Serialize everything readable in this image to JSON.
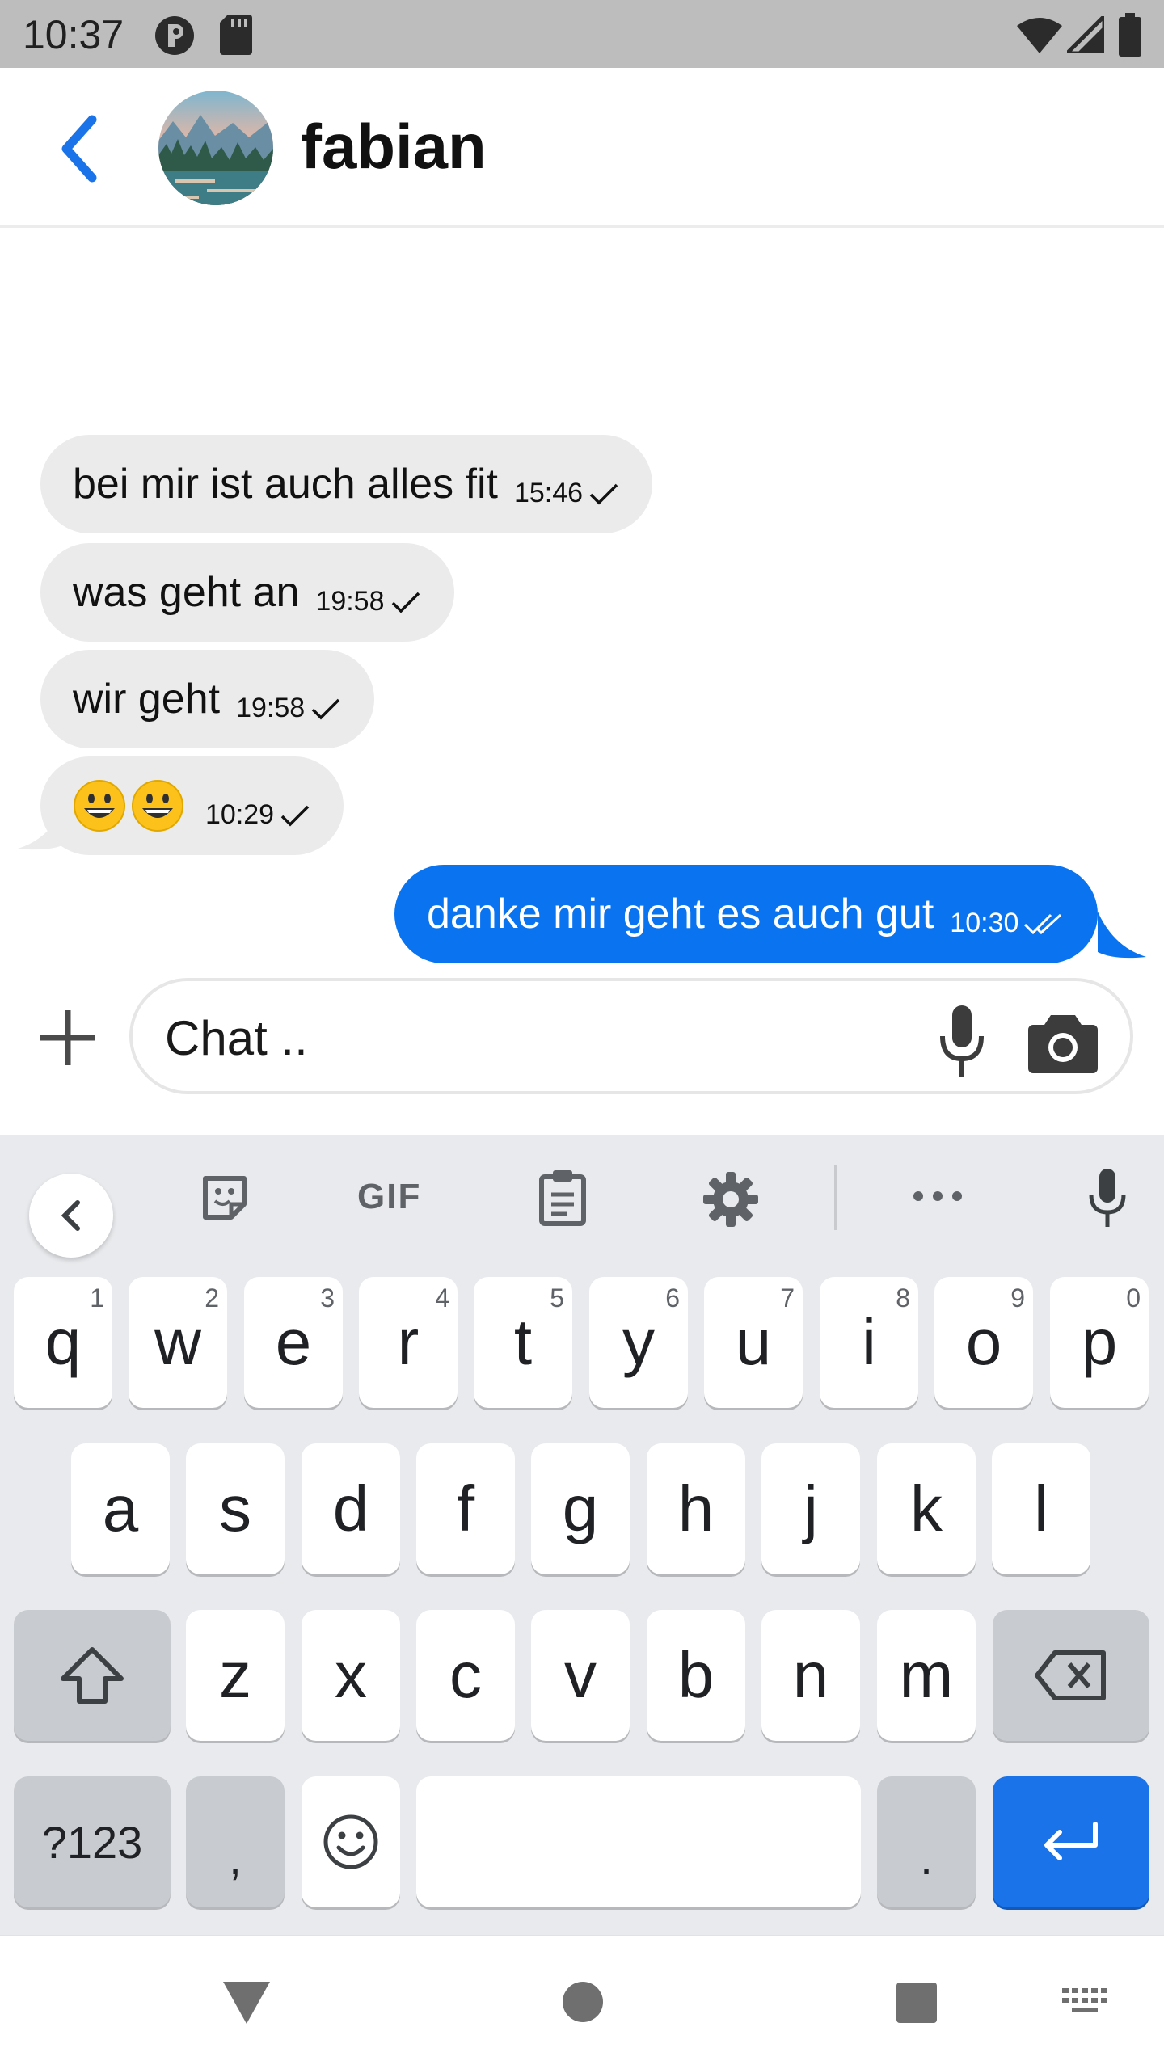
{
  "status_bar": {
    "time": "10:37"
  },
  "header": {
    "contact_name": "fabian"
  },
  "messages": [
    {
      "direction": "in",
      "text": "bei mir ist auch alles fit",
      "time": "15:46",
      "status": "sent"
    },
    {
      "direction": "in",
      "text": "was geht an",
      "time": "19:58",
      "status": "sent"
    },
    {
      "direction": "in",
      "text": "wir geht",
      "time": "19:58",
      "status": "sent"
    },
    {
      "direction": "in",
      "text": "😀😀",
      "time": "10:29",
      "status": "sent"
    },
    {
      "direction": "out",
      "text": "danke mir geht es auch gut",
      "time": "10:30",
      "status": "read"
    }
  ],
  "composer": {
    "placeholder": "Chat .."
  },
  "keyboard": {
    "toolbar": {
      "gif_label": "GIF"
    },
    "row1": [
      {
        "label": "q",
        "hint": "1"
      },
      {
        "label": "w",
        "hint": "2"
      },
      {
        "label": "e",
        "hint": "3"
      },
      {
        "label": "r",
        "hint": "4"
      },
      {
        "label": "t",
        "hint": "5"
      },
      {
        "label": "y",
        "hint": "6"
      },
      {
        "label": "u",
        "hint": "7"
      },
      {
        "label": "i",
        "hint": "8"
      },
      {
        "label": "o",
        "hint": "9"
      },
      {
        "label": "p",
        "hint": "0"
      }
    ],
    "row2": [
      "a",
      "s",
      "d",
      "f",
      "g",
      "h",
      "j",
      "k",
      "l"
    ],
    "row3": [
      "z",
      "x",
      "c",
      "v",
      "b",
      "n",
      "m"
    ],
    "symbols_label": "?123",
    "comma_label": ",",
    "period_label": ".",
    "accent_color": "#1a73e8"
  },
  "colors": {
    "outgoing_bubble": "#0a74f0",
    "incoming_bubble": "#ebebeb",
    "back_arrow": "#1a73e8"
  }
}
